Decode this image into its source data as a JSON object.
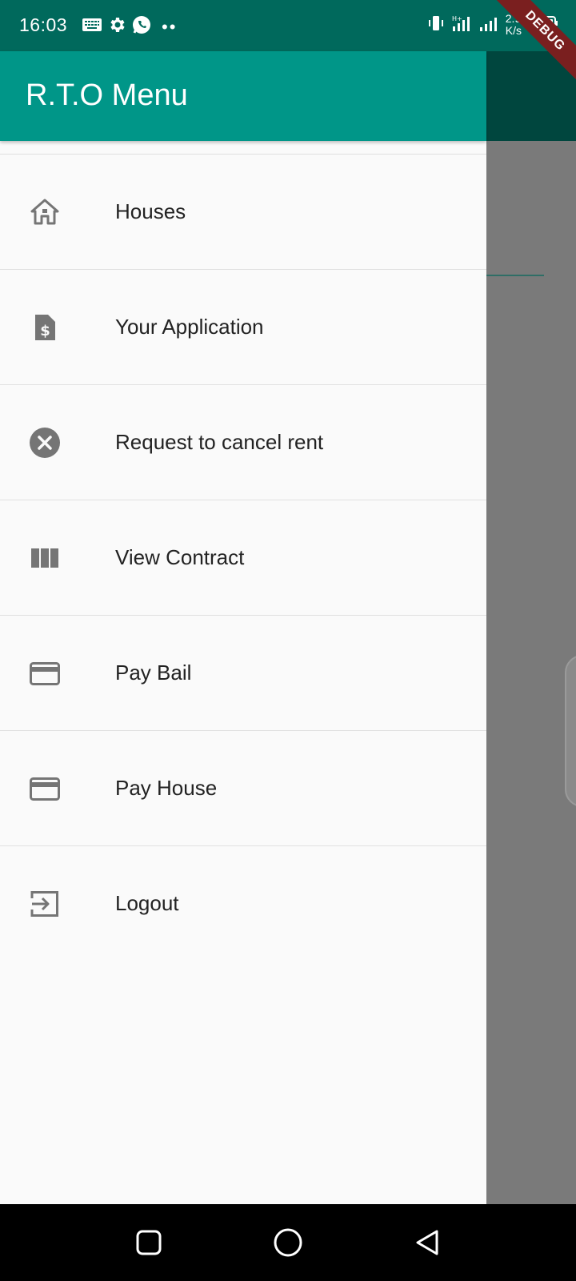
{
  "status_bar": {
    "time": "16:03",
    "net_speed_value": "2.9",
    "net_speed_unit": "K/s",
    "left_icons": [
      "keyboard-icon",
      "settings-icon",
      "whatsapp-icon"
    ],
    "right_icons": [
      "vibrate-icon",
      "signal-icon",
      "signal-icon",
      "battery-icon"
    ]
  },
  "debug_banner": "DEBUG",
  "drawer": {
    "title": "R.T.O Menu",
    "items": [
      {
        "label": "Houses",
        "icon": "house-icon"
      },
      {
        "label": "Your Application",
        "icon": "invoice-icon"
      },
      {
        "label": "Request to cancel rent",
        "icon": "cancel-icon"
      },
      {
        "label": "View Contract",
        "icon": "view-column-icon"
      },
      {
        "label": "Pay Bail",
        "icon": "credit-card-icon"
      },
      {
        "label": "Pay House",
        "icon": "credit-card-icon"
      },
      {
        "label": "Logout",
        "icon": "logout-icon"
      }
    ]
  },
  "colors": {
    "status_bar": "#00695c",
    "header": "#009688",
    "drawer_bg": "#fafafa",
    "icon": "#757575",
    "scrim": "#7a7a7a"
  },
  "nav_bar": {
    "buttons": [
      "recents-button",
      "home-button",
      "back-button"
    ]
  }
}
